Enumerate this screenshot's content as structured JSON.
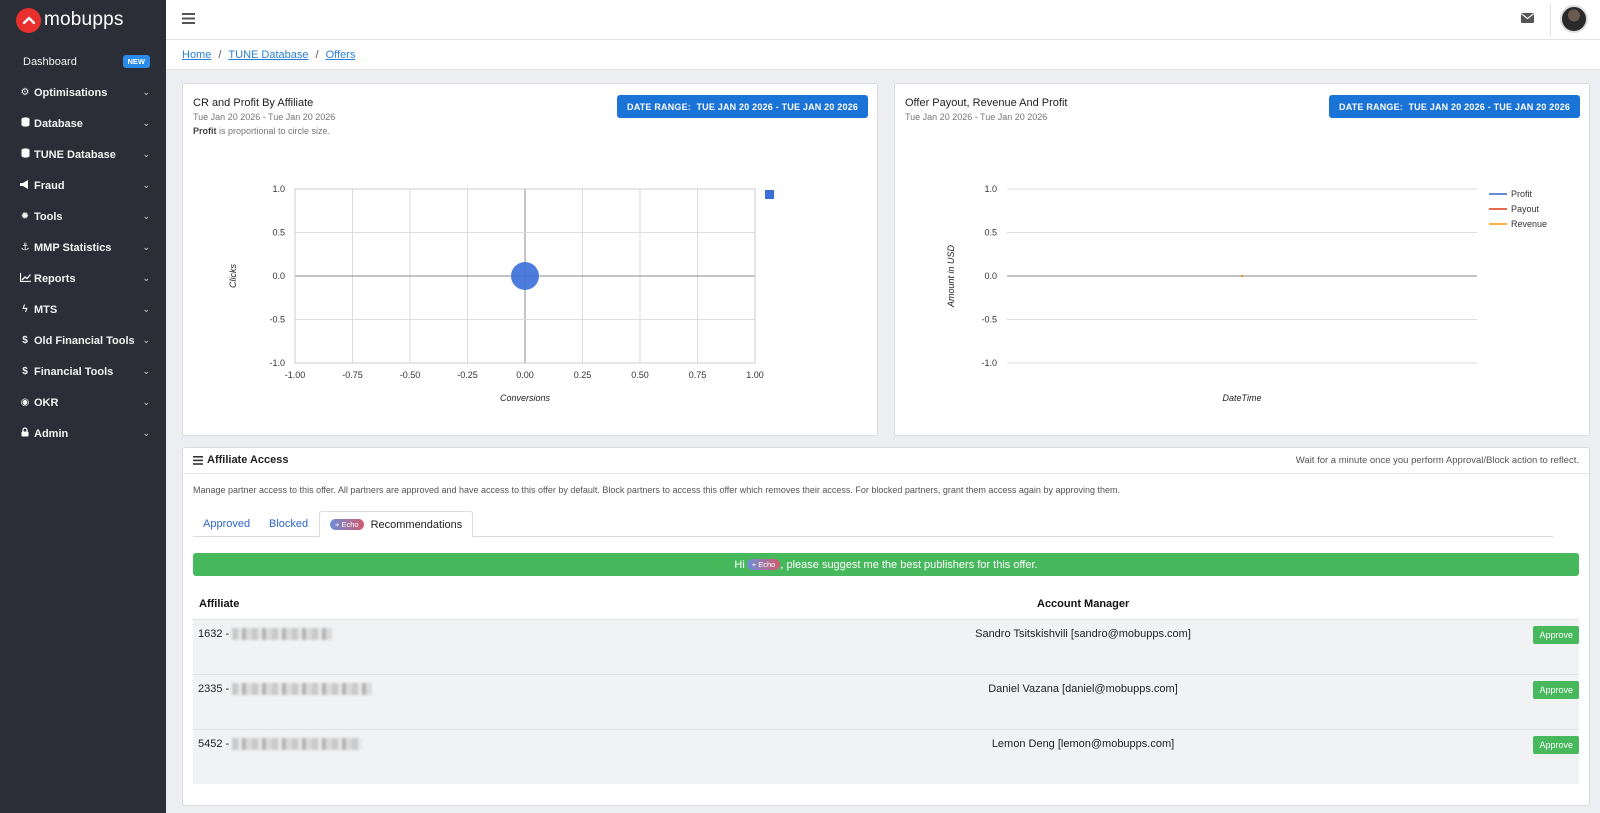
{
  "brand": {
    "name": "mobupps",
    "logo_color": "#e8312f"
  },
  "sidebar": {
    "dashboard": {
      "label": "Dashboard",
      "badge": "NEW"
    },
    "items": [
      {
        "label": "Optimisations",
        "icon": "cogs-icon"
      },
      {
        "label": "Database",
        "icon": "database-icon"
      },
      {
        "label": "TUNE Database",
        "icon": "database-icon"
      },
      {
        "label": "Fraud",
        "icon": "bullhorn-icon"
      },
      {
        "label": "Tools",
        "icon": "gear-icon"
      },
      {
        "label": "MMP Statistics",
        "icon": "anchor-icon"
      },
      {
        "label": "Reports",
        "icon": "line-chart-icon"
      },
      {
        "label": "MTS",
        "icon": "bolt-icon"
      },
      {
        "label": "Old Financial Tools",
        "icon": "dollar-icon"
      },
      {
        "label": "Financial Tools",
        "icon": "dollar-icon"
      },
      {
        "label": "OKR",
        "icon": "target-icon"
      },
      {
        "label": "Admin",
        "icon": "user-lock-icon"
      }
    ]
  },
  "breadcrumb": {
    "home": "Home",
    "sep": "/",
    "tune": "TUNE Database",
    "offers": "Offers"
  },
  "charts": {
    "left": {
      "title": "CR and Profit By Affiliate",
      "subtitle": "Tue Jan 20 2026 - Tue Jan 20 2026",
      "note_bold": "Profit",
      "note_rest": " is proportional to circle size.",
      "date_range_label": "DATE RANGE:",
      "date_range_value": "TUE JAN 20 2026 - TUE JAN 20 2026"
    },
    "right": {
      "title": "Offer Payout, Revenue And Profit",
      "subtitle": "Tue Jan 20 2026 - Tue Jan 20 2026",
      "date_range_label": "DATE RANGE:",
      "date_range_value": "TUE JAN 20 2026 - TUE JAN 20 2026"
    }
  },
  "chart_data": [
    {
      "type": "scatter",
      "title": "CR and Profit By Affiliate",
      "xlabel": "Conversions",
      "ylabel": "Clicks",
      "xlim": [
        -1.0,
        1.0
      ],
      "ylim": [
        -1.0,
        1.0
      ],
      "x_ticks": [
        "-1.00",
        "-0.75",
        "-0.50",
        "-0.25",
        "0.00",
        "0.25",
        "0.50",
        "0.75",
        "1.00"
      ],
      "y_ticks": [
        "1.0",
        "0.5",
        "0.0",
        "-0.5",
        "-1.0"
      ],
      "grid": true,
      "series": [
        {
          "color": "#3a6fd8",
          "points": [
            {
              "x": 0,
              "y": 0
            }
          ]
        }
      ]
    },
    {
      "type": "line",
      "title": "Offer Payout, Revenue And Profit",
      "xlabel": "DateTime",
      "ylabel": "Amount in USD",
      "ylim": [
        -1.0,
        1.0
      ],
      "y_ticks": [
        "1.0",
        "0.5",
        "0.0",
        "-0.5",
        "-1.0"
      ],
      "legend": "top-right",
      "series": [
        {
          "name": "Profit",
          "color": "#3366cc",
          "values": [
            0
          ]
        },
        {
          "name": "Payout",
          "color": "#dc3912",
          "values": [
            0
          ]
        },
        {
          "name": "Revenue",
          "color": "#ff9900",
          "values": [
            0
          ]
        }
      ]
    }
  ],
  "affiliate_access": {
    "title": "Affiliate Access",
    "notice": "Wait for a minute once you perform Approval/Block action to reflect.",
    "description": "Manage partner access to this offer. All partners are approved and have access to this offer by default. Block partners to access this offer which removes their access. For blocked partners, grant them access again by approving them.",
    "tabs": {
      "approved": "Approved",
      "blocked": "Blocked",
      "echo_badge": "+ Echo",
      "recommendations": "Recommendations"
    },
    "suggest": {
      "prefix": "Hi",
      "echo_badge": "+ Echo",
      "suffix": ", please suggest me the best publishers for this offer."
    },
    "columns": {
      "affiliate": "Affiliate",
      "account_manager": "Account Manager"
    },
    "rows": [
      {
        "affiliate_id": "1632 -",
        "account_manager": "Sandro Tsitskishvili [sandro@mobupps.com]",
        "action": "Approve"
      },
      {
        "affiliate_id": "2335 -",
        "account_manager": "Daniel Vazana [daniel@mobupps.com]",
        "action": "Approve"
      },
      {
        "affiliate_id": "5452 -",
        "account_manager": "Lemon Deng [lemon@mobupps.com]",
        "action": "Approve"
      }
    ]
  }
}
